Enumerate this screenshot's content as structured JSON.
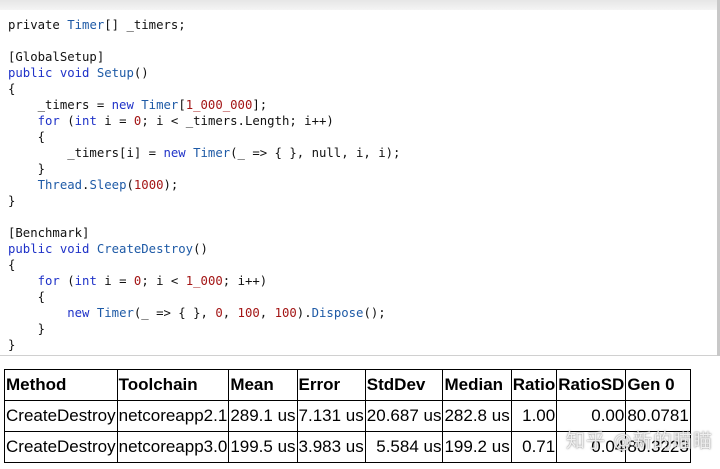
{
  "code_lines": [
    [
      [
        "pl",
        "private "
      ],
      [
        "ty",
        "Timer"
      ],
      [
        "pl",
        "[] _timers;"
      ]
    ],
    [],
    [
      [
        "pl",
        "[GlobalSetup]"
      ]
    ],
    [
      [
        "kw",
        "public void "
      ],
      [
        "ty",
        "Setup"
      ],
      [
        "pl",
        "()"
      ]
    ],
    [
      [
        "pl",
        "{"
      ]
    ],
    [
      [
        "pl",
        "    _timers = "
      ],
      [
        "kw",
        "new "
      ],
      [
        "ty",
        "Timer"
      ],
      [
        "pl",
        "["
      ],
      [
        "num",
        "1_000_000"
      ],
      [
        "pl",
        "];"
      ]
    ],
    [
      [
        "pl",
        "    "
      ],
      [
        "kw",
        "for "
      ],
      [
        "pl",
        "("
      ],
      [
        "kw",
        "int "
      ],
      [
        "pl",
        "i = "
      ],
      [
        "num",
        "0"
      ],
      [
        "pl",
        "; i < _timers.Length; i++)"
      ]
    ],
    [
      [
        "pl",
        "    {"
      ]
    ],
    [
      [
        "pl",
        "        _timers[i] = "
      ],
      [
        "kw",
        "new "
      ],
      [
        "ty",
        "Timer"
      ],
      [
        "pl",
        "(_ => { }, null, i, i);"
      ]
    ],
    [
      [
        "pl",
        "    }"
      ]
    ],
    [
      [
        "pl",
        "    "
      ],
      [
        "ty",
        "Thread"
      ],
      [
        "pl",
        "."
      ],
      [
        "ty",
        "Sleep"
      ],
      [
        "pl",
        "("
      ],
      [
        "num",
        "1000"
      ],
      [
        "pl",
        ");"
      ]
    ],
    [
      [
        "pl",
        "}"
      ]
    ],
    [],
    [
      [
        "pl",
        "[Benchmark]"
      ]
    ],
    [
      [
        "kw",
        "public void "
      ],
      [
        "ty",
        "CreateDestroy"
      ],
      [
        "pl",
        "()"
      ]
    ],
    [
      [
        "pl",
        "{"
      ]
    ],
    [
      [
        "pl",
        "    "
      ],
      [
        "kw",
        "for "
      ],
      [
        "pl",
        "("
      ],
      [
        "kw",
        "int "
      ],
      [
        "pl",
        "i = "
      ],
      [
        "num",
        "0"
      ],
      [
        "pl",
        "; i < "
      ],
      [
        "num",
        "1_000"
      ],
      [
        "pl",
        "; i++)"
      ]
    ],
    [
      [
        "pl",
        "    {"
      ]
    ],
    [
      [
        "pl",
        "        "
      ],
      [
        "kw",
        "new "
      ],
      [
        "ty",
        "Timer"
      ],
      [
        "pl",
        "(_ => { }, "
      ],
      [
        "num",
        "0"
      ],
      [
        "pl",
        ", "
      ],
      [
        "num",
        "100"
      ],
      [
        "pl",
        ", "
      ],
      [
        "num",
        "100"
      ],
      [
        "pl",
        ")."
      ],
      [
        "ty",
        "Dispose"
      ],
      [
        "pl",
        "();"
      ]
    ],
    [
      [
        "pl",
        "    }"
      ]
    ],
    [
      [
        "pl",
        "}"
      ]
    ]
  ],
  "table": {
    "headers": [
      "Method",
      "Toolchain",
      "Mean",
      "Error",
      "StdDev",
      "Median",
      "Ratio",
      "RatioSD",
      "Gen 0"
    ],
    "rows": [
      [
        "CreateDestroy",
        "netcoreapp2.1",
        "289.1 us",
        "7.131 us",
        "20.687 us",
        "282.8 us",
        "1.00",
        "0.00",
        "80.0781"
      ],
      [
        "CreateDestroy",
        "netcoreapp3.0",
        "199.5 us",
        "3.983 us",
        "5.584 us",
        "199.2 us",
        "0.71",
        "0.04",
        "80.3223"
      ]
    ],
    "align": [
      "l",
      "l",
      "r",
      "r",
      "r",
      "r",
      "r",
      "r",
      "r"
    ]
  },
  "watermark": "知乎 @新的瞄瞄"
}
